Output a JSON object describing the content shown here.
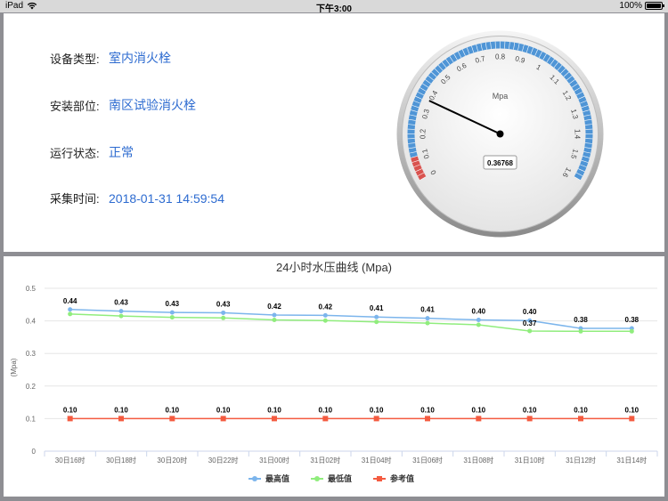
{
  "statusbar": {
    "device": "iPad",
    "time": "下午3:00",
    "battery": "100%"
  },
  "info": {
    "device_type_label": "设备类型:",
    "device_type_value": "室内消火栓",
    "location_label": "安装部位:",
    "location_value": "南区试验消火栓",
    "status_label": "运行状态:",
    "status_value": "正常",
    "time_label": "采集时间:",
    "time_value": "2018-01-31 14:59:54"
  },
  "gauge": {
    "unit": "Mpa",
    "value": 0.36768,
    "value_text": "0.36768",
    "min": 0,
    "max": 1.6,
    "tick_labels": [
      "0",
      "0.1",
      "0.2",
      "0.3",
      "0.4",
      "0.5",
      "0.6",
      "0.7",
      "0.8",
      "0.9",
      "1",
      "1.1",
      "1.2",
      "1.3",
      "1.4",
      "1.5",
      "1.6"
    ],
    "band_color": "#4f95d6",
    "alarm_color": "#d9534f",
    "alarm_range": [
      0,
      0.1
    ]
  },
  "chart_data": {
    "type": "line",
    "title": "24小时水压曲线 (Mpa)",
    "ylabel": "(Mpa)",
    "ylim": [
      0,
      0.5
    ],
    "yticks": [
      "0",
      "0.1",
      "0.2",
      "0.3",
      "0.4",
      "0.5"
    ],
    "categories": [
      "30日16时",
      "30日18时",
      "30日20时",
      "30日22时",
      "31日00时",
      "31日02时",
      "31日04时",
      "31日06时",
      "31日08时",
      "31日10时",
      "31日12时",
      "31日14时"
    ],
    "series": [
      {
        "name": "最高值",
        "color": "#7cb5ec",
        "values": [
          0.435,
          0.43,
          0.426,
          0.425,
          0.418,
          0.417,
          0.412,
          0.408,
          0.403,
          0.401,
          0.377,
          0.377
        ],
        "labels": [
          "0.44",
          "0.43",
          "0.43",
          "0.43",
          "0.42",
          "0.42",
          "0.41",
          "0.41",
          "0.40",
          "0.40",
          "0.38",
          "0.38"
        ]
      },
      {
        "name": "最低值",
        "color": "#90ed7d",
        "values": [
          0.421,
          0.415,
          0.411,
          0.409,
          0.403,
          0.401,
          0.397,
          0.393,
          0.388,
          0.369,
          0.368,
          0.368
        ],
        "labels": [
          "",
          "",
          "",
          "",
          "",
          "",
          "",
          "",
          "",
          "0.37",
          "",
          ""
        ]
      },
      {
        "name": "参考值",
        "color": "#f45b40",
        "values": [
          0.1,
          0.1,
          0.1,
          0.1,
          0.1,
          0.1,
          0.1,
          0.1,
          0.1,
          0.1,
          0.1,
          0.1
        ],
        "labels": [
          "0.10",
          "0.10",
          "0.10",
          "0.10",
          "0.10",
          "0.10",
          "0.10",
          "0.10",
          "0.10",
          "0.10",
          "0.10",
          "0.10"
        ]
      }
    ],
    "grid": true,
    "legend": "bottom-center"
  }
}
